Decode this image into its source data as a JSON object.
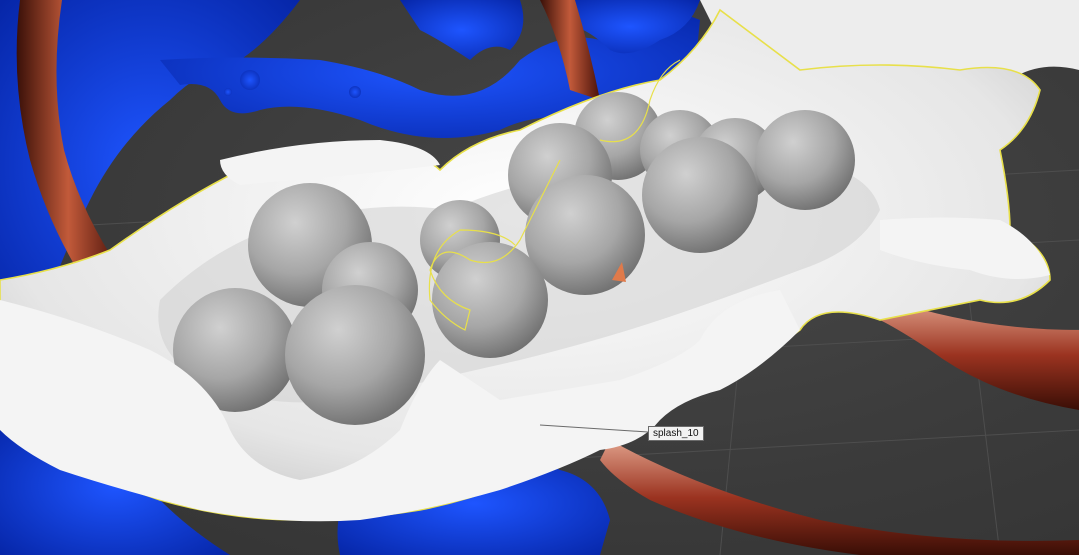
{
  "viewport": {
    "background_color": "#3f3f3f",
    "grid_color": "#4d4d4d",
    "selection_outline_color": "#e8e04a",
    "fluid_color": "#0a3cf0",
    "splash_color": "#f2f2f2",
    "sphere_color": "#a8a8a8",
    "ring_color": "#a83a22"
  },
  "selected_object": {
    "label": "splash_10"
  }
}
